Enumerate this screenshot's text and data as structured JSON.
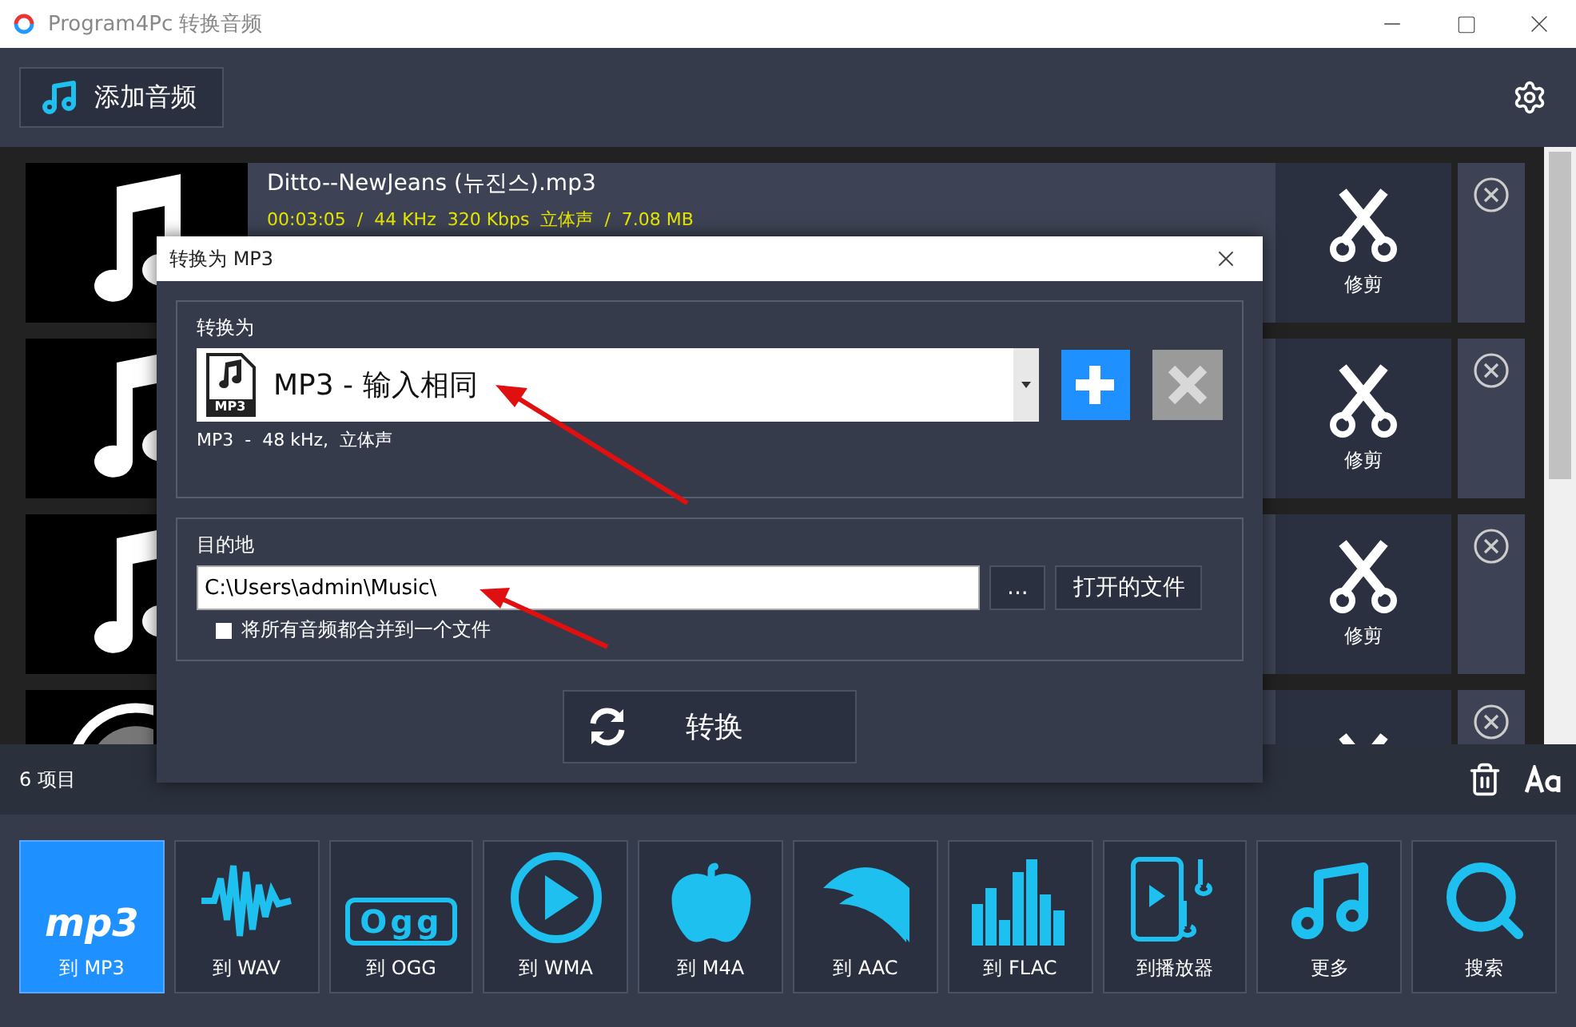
{
  "window": {
    "title": "Program4Pc 转换音频"
  },
  "toolbar": {
    "add_button": "添加音频"
  },
  "tracks": [
    {
      "kind": "note",
      "title": "Ditto--NewJeans (뉴진스).mp3",
      "meta": "00:03:05  /  44 KHz  320 Kbps  立体声  /  7.08 MB",
      "trim_label": "修剪"
    },
    {
      "kind": "note",
      "trim_label": "修剪"
    },
    {
      "kind": "note",
      "trim_label": "修剪"
    },
    {
      "kind": "disc"
    }
  ],
  "status": {
    "count": "6 项目"
  },
  "formats": [
    {
      "logo_text": "mp3",
      "label": "到 MP3",
      "selected": true
    },
    {
      "label": "到 WAV",
      "selected": false
    },
    {
      "logo_text": "Ogg",
      "label": "到 OGG",
      "selected": false
    },
    {
      "label": "到 WMA",
      "selected": false
    },
    {
      "label": "到 M4A",
      "selected": false
    },
    {
      "label": "到 AAC",
      "selected": false
    },
    {
      "label": "到 FLAC",
      "selected": false
    },
    {
      "label": "到播放器",
      "selected": false
    },
    {
      "label": "更多",
      "selected": false
    },
    {
      "label": "搜索",
      "selected": false
    }
  ],
  "dialog": {
    "title": "转换为 MP3",
    "convert_to_label": "转换为",
    "preset": "MP3 - 输入相同",
    "preset_icon_text": "MP3",
    "preset_info": "MP3  -  48 kHz,  立体声",
    "remove_disabled": true,
    "destination_label": "目的地",
    "path": "C:\\Users\\admin\\Music\\",
    "browse": "...",
    "open_folder": "打开的文件",
    "merge": {
      "label": "将所有音频都合并到一个文件",
      "checked": false
    },
    "convert": "转换"
  }
}
